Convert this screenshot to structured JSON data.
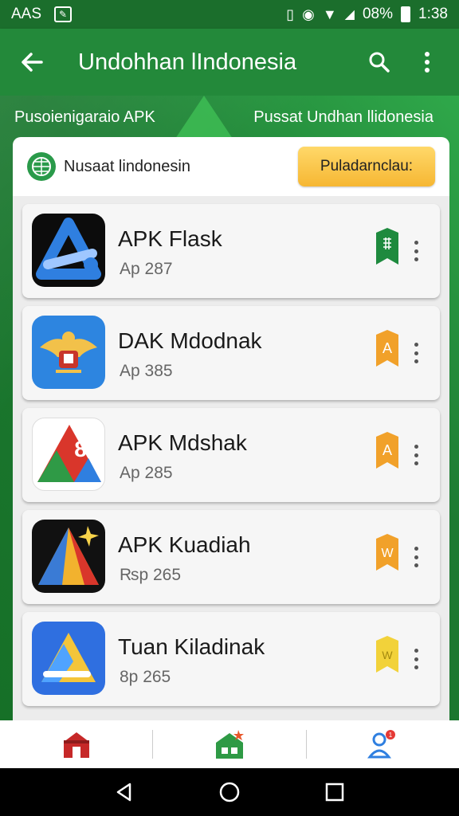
{
  "status_bar": {
    "carrier": "AAS",
    "battery": "08%",
    "time": "1:38"
  },
  "app_bar": {
    "title": "Undohhan lIndonesia"
  },
  "sections": {
    "left_label": "Pusoienigaraio APK",
    "right_label": "Pussat Undhan llidonesia"
  },
  "header": {
    "store_name": "Nusaat lindonesin",
    "promo_button": "Puladarnclau:"
  },
  "apps": [
    {
      "name": "APK Flask",
      "price": "Ap 287",
      "badge_color": "#1e8a3e",
      "badge_text": "",
      "icon": "blue-triangle-app-icon"
    },
    {
      "name": "DAK Mdodnak",
      "price": "Ap 385",
      "badge_color": "#f1a12a",
      "badge_text": "A",
      "icon": "garuda-emblem-icon"
    },
    {
      "name": "APK Mdshak",
      "price": "Ap 285",
      "badge_color": "#f1a12a",
      "badge_text": "A",
      "icon": "red-green-triangle-app-icon"
    },
    {
      "name": "APK Kuadiah",
      "price": "₨p 265",
      "badge_color": "#f1a12a",
      "badge_text": "W",
      "icon": "dark-triangle-app-icon"
    },
    {
      "name": "Tuan Kiladinak",
      "price": "8p 265",
      "badge_color": "#f2d23a",
      "badge_text": "W",
      "icon": "blue-yellow-app-icon"
    }
  ],
  "colors": {
    "primary": "#23893a",
    "accent": "#f6b733"
  },
  "bottom_nav": [
    "home-icon",
    "store-icon",
    "account-icon"
  ]
}
